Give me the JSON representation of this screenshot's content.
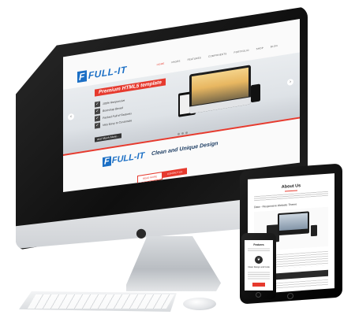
{
  "brand": {
    "logo_mark": "F",
    "logo_text": "FULL-IT",
    "accent": "#e63a2e",
    "brand_blue": "#1b6fc5"
  },
  "desktop_site": {
    "menu": [
      "HOME",
      "PAGES",
      "FEATURES",
      "COMPONENTS",
      "PORTFOLIO",
      "SHOP",
      "BLOG"
    ],
    "banner": "Premium HTML5 template",
    "features": [
      "100% Responsive",
      "Bootstrap Based",
      "Packed Full of Features",
      "Very Easy to Customize"
    ],
    "more_button": "And Much More...",
    "tagline": "Clean and Unique Design",
    "read_more": "READ MORE",
    "contact_us": "CONTACT US"
  },
  "tablet_site": {
    "title": "About Us",
    "subtitle": "Data - Responsive Website Theme"
  },
  "phone_site": {
    "title": "Features",
    "subtitle": "Clean Design and Code",
    "icon": "leaf-icon"
  },
  "apple_logo": "apple-icon"
}
